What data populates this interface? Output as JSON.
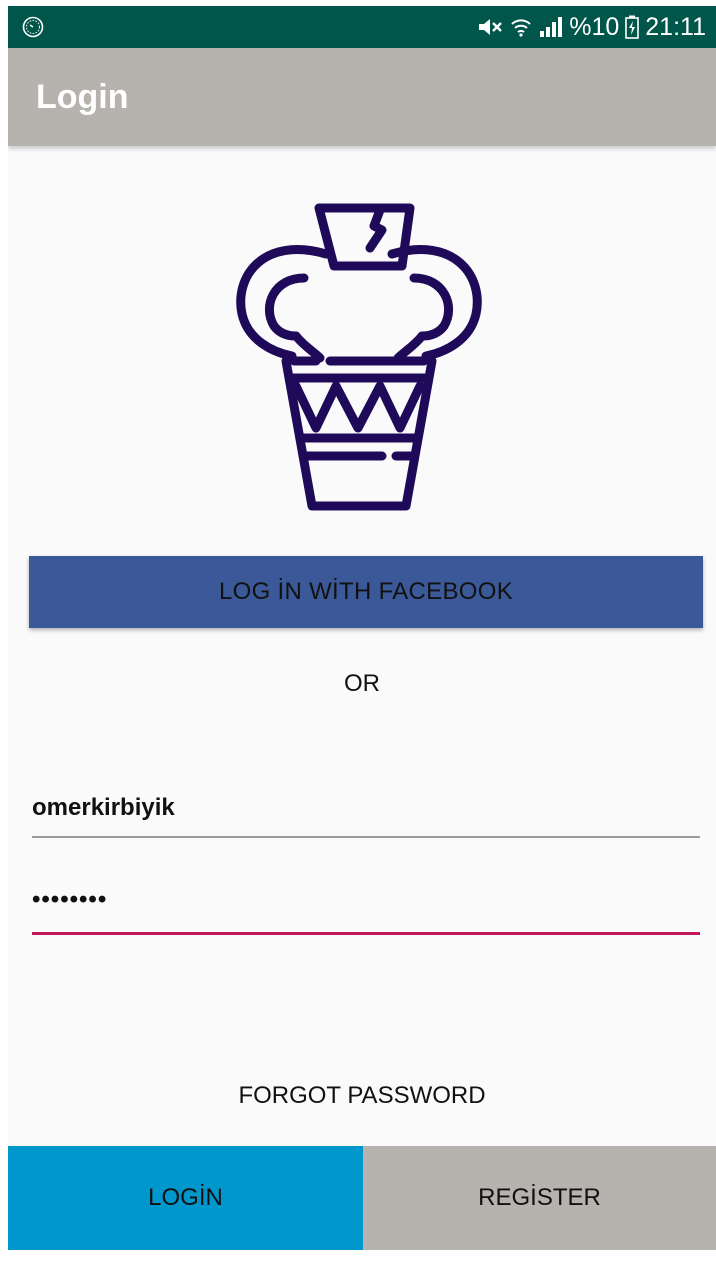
{
  "status_bar": {
    "battery_percent": "%10",
    "time": "21:11",
    "icons": [
      "clock-icon",
      "mute-icon",
      "wifi-icon",
      "signal-icon",
      "battery-icon"
    ]
  },
  "app_bar": {
    "title": "Login"
  },
  "logo": {
    "icon": "amphora-vase-icon",
    "color": "#1f0a5a"
  },
  "facebook_button": {
    "label": "LOG İN WİTH FACEBOOK",
    "color": "#3b5998"
  },
  "separator": {
    "text": "OR"
  },
  "form": {
    "username": {
      "value": "omerkirbiyik"
    },
    "password": {
      "value": "••••••••",
      "accent_color": "#c2185b"
    }
  },
  "forgot_password": {
    "label": "FORGOT PASSWORD"
  },
  "bottom_bar": {
    "login_label": "LOGİN",
    "login_color": "#0097cc",
    "register_label": "REGİSTER",
    "register_color": "#b6b2ae"
  },
  "colors": {
    "status_bar": "#00564a",
    "app_bar": "#b6b2ae"
  }
}
